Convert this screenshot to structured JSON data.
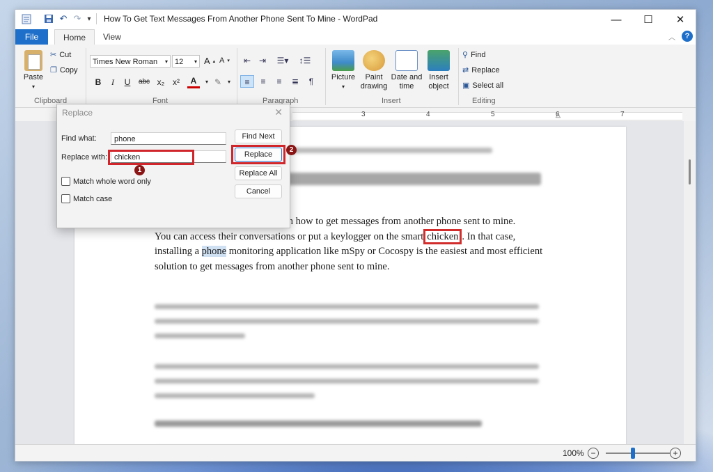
{
  "window": {
    "title": "How To Get Text Messages From Another Phone Sent To Mine - WordPad",
    "controls": {
      "minimize": "—",
      "maximize": "☐",
      "close": "✕"
    }
  },
  "quick_access": [
    "save-icon",
    "undo-icon",
    "redo-icon",
    "customize-icon"
  ],
  "ribbon": {
    "tabs": {
      "file": "File",
      "home": "Home",
      "view": "View"
    },
    "clipboard": {
      "paste": "Paste",
      "cut": "Cut",
      "copy": "Copy",
      "label": "Clipboard"
    },
    "font": {
      "family": "Times New Roman",
      "size": "12",
      "label": "Font",
      "buttons": {
        "bold": "B",
        "italic": "I",
        "underline": "U",
        "strike": "abc",
        "sub": "x₂",
        "sup": "x²",
        "color": "A"
      }
    },
    "paragraph": {
      "label": "Paragraph"
    },
    "insert": {
      "picture": "Picture",
      "paint1": "Paint",
      "paint2": "drawing",
      "date1": "Date and",
      "date2": "time",
      "obj1": "Insert",
      "obj2": "object",
      "label": "Insert"
    },
    "editing": {
      "find": "Find",
      "replace": "Replace",
      "select_all": "Select all",
      "label": "Editing"
    }
  },
  "ruler": {
    "marks": [
      "3",
      "4",
      "5",
      "6",
      "7"
    ]
  },
  "document": {
    "line1": "You can access their conversations or put a keylogger on the smart",
    "highlight_word": "chicken",
    "line1_end": ". In that case,",
    "line2_pre": "installing a ",
    "line2_phone": "phone",
    "line2_post": " monitoring application like mSpy or Cocospy is the easiest and most efficient",
    "line3": "solution to get messages from another phone sent to mine.",
    "line0_tail": "learn how to get messages from another phone sent to mine."
  },
  "dialog": {
    "title": "Replace",
    "find_label": "Find what:",
    "find_value": "phone",
    "replace_label": "Replace with:",
    "replace_value": "chicken",
    "match_whole": "Match whole word only",
    "match_case": "Match case",
    "buttons": {
      "find_next": "Find Next",
      "replace": "Replace",
      "replace_all": "Replace All",
      "cancel": "Cancel"
    },
    "annotations": {
      "step1": "1",
      "step2": "2"
    }
  },
  "status": {
    "zoom": "100%"
  }
}
